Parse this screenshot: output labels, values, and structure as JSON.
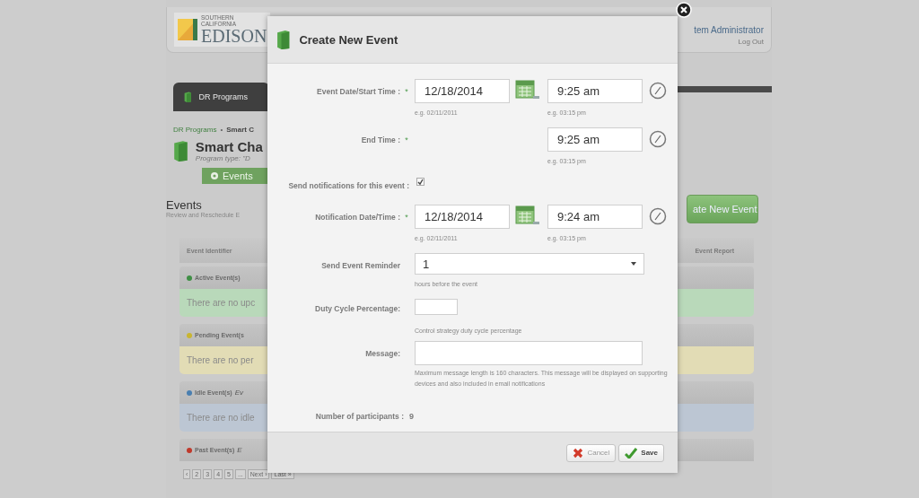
{
  "header": {
    "logo_top": "SOUTHERN CALIFORNIA",
    "logo_name": "EDISON",
    "user": "tem Administrator",
    "logout": "Log Out"
  },
  "nav": {
    "tabs": [
      {
        "label": "DR Programs",
        "selected": true
      }
    ]
  },
  "breadcrumb": {
    "parent": "DR Programs",
    "separator": "•",
    "current": "Smart C"
  },
  "program": {
    "title": "Smart Cha",
    "type": "Program type: \"D"
  },
  "subtabs": [
    {
      "label": "Events",
      "selected": true
    }
  ],
  "events": {
    "title": "Events",
    "subtitle": "Review and Reschedule E",
    "create_button": "ate New Event",
    "columns": [
      "Event Identifier",
      "Event Report"
    ],
    "groups": [
      {
        "kind": "active",
        "label": "Active Event(s)",
        "color": "#3f8f45",
        "message": "There are no upc"
      },
      {
        "kind": "pending",
        "label": "Pending Event(s",
        "color": "#c9b531",
        "message": "There are no per"
      },
      {
        "kind": "idle",
        "label": "Idle Event(s)",
        "note": "Ev",
        "color": "#4a7fb0",
        "message": "There are no idle"
      },
      {
        "kind": "past",
        "label": "Past Event(s)",
        "note": "E",
        "color": "#c0392b"
      }
    ],
    "pagination": [
      "‹",
      "2",
      "3",
      "4",
      "5",
      "...",
      "Next ›",
      "Last »"
    ]
  },
  "dialog": {
    "title": "Create New Event",
    "rows": [
      {
        "kind": "datetime",
        "label": "Event Date/Start Time :",
        "marker": "*",
        "date": "12/18/2014",
        "date_hint": "e.g. 02/11/2011",
        "time": "9:25 am",
        "time_hint": "e.g. 03:15 pm"
      },
      {
        "kind": "time",
        "label": "End Time :",
        "marker": "*",
        "time": "9:25 am",
        "time_hint": "e.g. 03:15 pm"
      },
      {
        "kind": "checkbox",
        "label": "Send notifications for this event :",
        "checked": true
      },
      {
        "kind": "datetime",
        "label": "Notification Date/Time :",
        "marker": "*",
        "date": "12/18/2014",
        "date_hint": "e.g. 02/11/2011",
        "time": "9:24 am",
        "time_hint": "e.g. 03:15 pm"
      },
      {
        "kind": "select",
        "label": "Send Event Reminder",
        "value": "1",
        "hint": "hours before the event"
      },
      {
        "kind": "short",
        "label": "Duty Cycle Percentage:",
        "hint": "Control strategy duty cycle percentage"
      },
      {
        "kind": "text",
        "label": "Message:",
        "hint": "Maximum message length is 160 characters. This message will be displayed on supporting devices and also included in email notifications"
      },
      {
        "kind": "static",
        "label": "Number of participants :",
        "value": "9"
      }
    ],
    "buttons": [
      {
        "kind": "cancel",
        "label": "Cancel"
      },
      {
        "kind": "save",
        "label": "Save"
      }
    ]
  }
}
